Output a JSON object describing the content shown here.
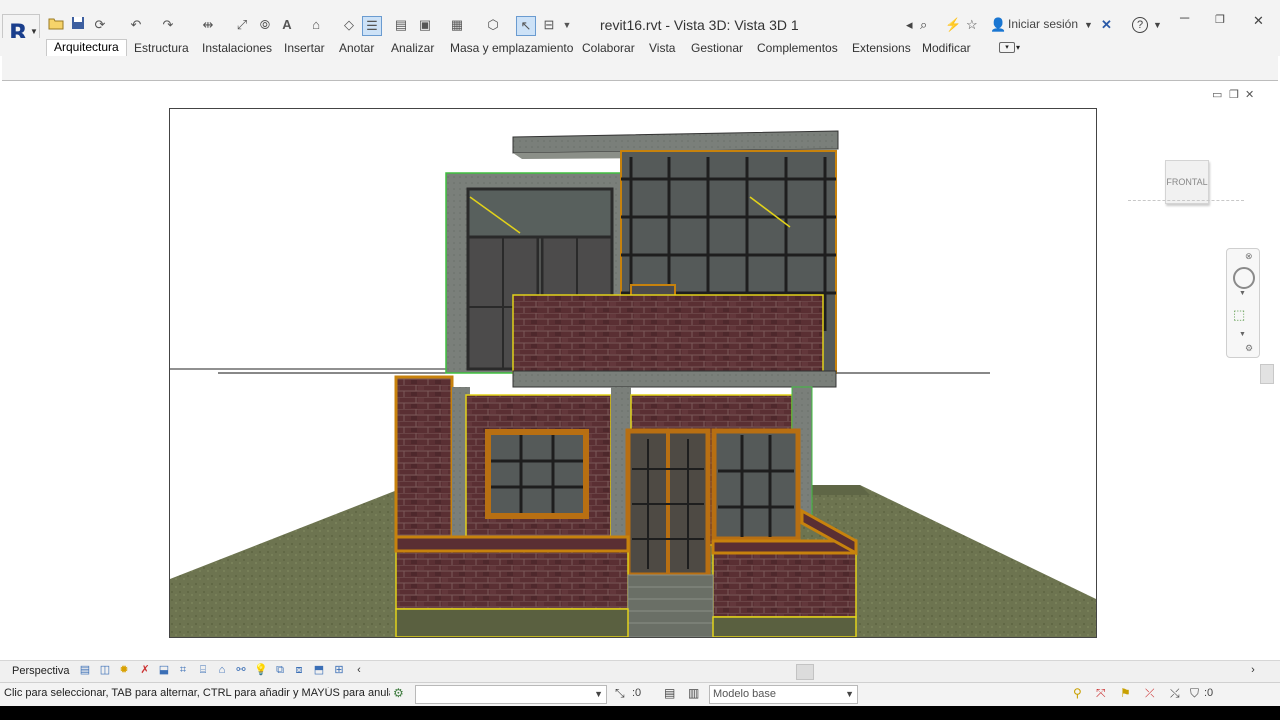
{
  "app": {
    "logo_letter": "R",
    "document_title": "revit16.rvt - Vista 3D: Vista 3D 1",
    "login_label": "Iniciar sesión",
    "help_label": "?"
  },
  "ribbon": {
    "tabs": [
      "Arquitectura",
      "Estructura",
      "Instalaciones",
      "Insertar",
      "Anotar",
      "Analizar",
      "Masa y emplazamiento",
      "Colaborar",
      "Vista",
      "Gestionar",
      "Complementos",
      "Extensions",
      "Modificar"
    ],
    "selected_tab": "Arquitectura"
  },
  "viewcube": {
    "face_label": "FRONTAL"
  },
  "view_control_bar": {
    "view_mode": "Perspectiva"
  },
  "statusbar": {
    "message": "Clic para seleccionar, TAB para alternar, CTRL para añadir y MAYÚS para anula",
    "workset_value": "",
    "rotation_value": ":0",
    "design_option": "Modelo base",
    "filter_count": ":0"
  },
  "colors": {
    "brick": "#5a2f33",
    "mortar": "#7b5a5a",
    "trim": "#c7820d",
    "highlight": "#e2d21a",
    "grass": "#6d7450",
    "sky": "#ffffff",
    "glass": "#555a59",
    "frame": "#2e2e2e",
    "slab": "#7a7f7a"
  },
  "icons": {
    "quick_access": [
      "open-icon",
      "save-icon",
      "sync-icon",
      "undo-icon",
      "redo-icon",
      "measure-icon",
      "dimension-icon",
      "tag-icon",
      "text-icon",
      "3d-view-icon",
      "section-icon",
      "thin-lines-icon",
      "close-hidden-icon",
      "switch-windows-icon",
      "modify-select-icon",
      "customize-icon"
    ]
  }
}
